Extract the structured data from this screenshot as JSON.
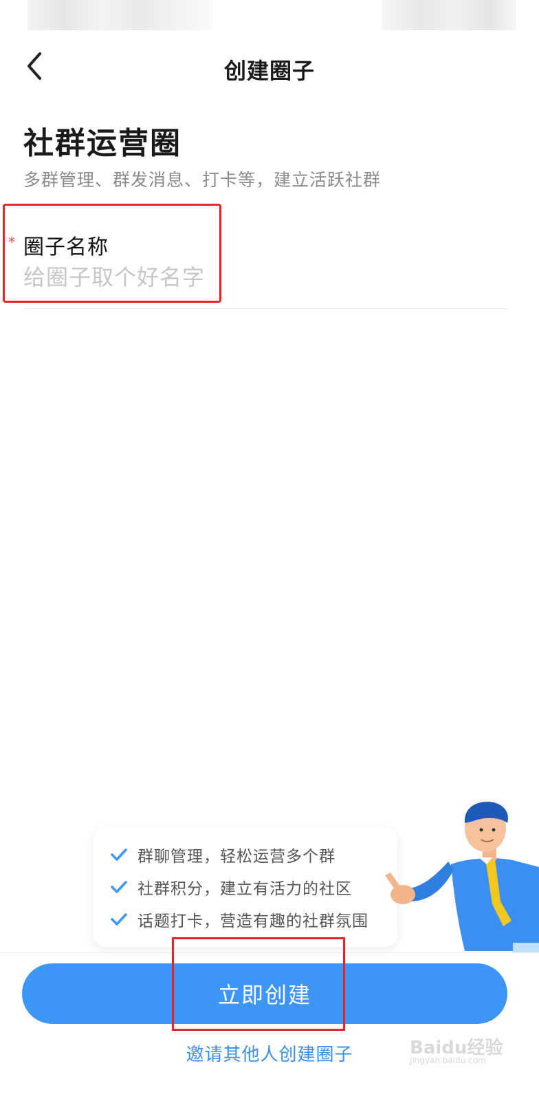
{
  "nav": {
    "title": "创建圈子",
    "back_icon": "chevron-left-icon"
  },
  "header": {
    "headline": "社群运营圈",
    "subtitle": "多群管理、群发消息、打卡等，建立活跃社群"
  },
  "form": {
    "name_field": {
      "required_mark": "*",
      "label": "圈子名称",
      "placeholder": "给圈子取个好名字",
      "value": ""
    }
  },
  "features": {
    "items": [
      {
        "icon": "check-icon",
        "text": "群聊管理，轻松运营多个群"
      },
      {
        "icon": "check-icon",
        "text": "社群积分，建立有活力的社区"
      },
      {
        "icon": "check-icon",
        "text": "话题打卡，营造有趣的社群氛围"
      }
    ]
  },
  "actions": {
    "create_label": "立即创建",
    "invite_label": "邀请其他人创建圈子"
  },
  "watermark": {
    "text": "Baidu经验",
    "sub": "jingyan.baidu.com"
  },
  "colors": {
    "primary": "#3d96f6",
    "link": "#3a8fe8",
    "highlight": "#e8242b",
    "required": "#e94b4b"
  }
}
